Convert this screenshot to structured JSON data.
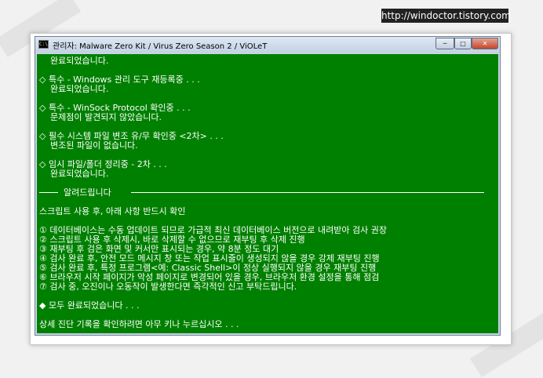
{
  "watermark": "http://windoctor.tistory.com",
  "window": {
    "title": "관리자:  Malware Zero Kit / Virus Zero Season 2 / ViOLeT",
    "btn_min": "─",
    "btn_max": "□",
    "btn_close": "✕"
  },
  "console": {
    "lines": [
      "    완료되었습니다.",
      "",
      "◇ 특수 - Windows 관리 도구 재등록중 . . .",
      "    완료되었습니다.",
      "",
      "◇ 특수 - WinSock Protocol 확인중 . . .",
      "    문제점이 발견되지 않았습니다.",
      "",
      "◇ 필수 시스템 파일 변조 유/무 확인중 <2차> . . .",
      "    변조된 파일이 없습니다.",
      "",
      "◇ 임시 파일/폴더 정리중 - 2차 . . .",
      "    완료되었습니다."
    ],
    "separator_label": "알려드립니다",
    "notice_header": "스크립트 사용 후, 아래 사항 반드시 확인",
    "notices": [
      "① 데이터베이스는 수동 업데이트 되므로 가급적 최신 데이터베이스 버전으로 내려받아 검사 권장",
      "② 스크립트 사용 후 삭제시, 바로 삭제할 수 없으므로 재부팅 후 삭제 진행",
      "③ 재부팅 후 검은 화면 및 커서만 표시되는 경우, 약 8분 정도 대기",
      "④ 검사 완료 후, 안전 모드 메시지 창 또는 작업 표시줄이 생성되지 않을 경우 강제 재부팅 진행",
      "⑤ 검사 완료 후, 특정 프로그램<예: Classic Shell>이 정상 실행되지 않을 경우 재부팅 진행",
      "⑥ 브라우저 시작 페이지가 악성 페이지로 변경되어 있을 경우, 브라우저 환경 설정을 통해 점검",
      "⑦ 검사 중, 오진이나 오동작이 발생한다면 즉각적인 신고 부탁드립니다."
    ],
    "done_message": "◆ 모두 완료되었습니다 . . .",
    "prompt": "상세 진단 기록을 확인하려면 아무 키나 누르십시오 . . ."
  }
}
